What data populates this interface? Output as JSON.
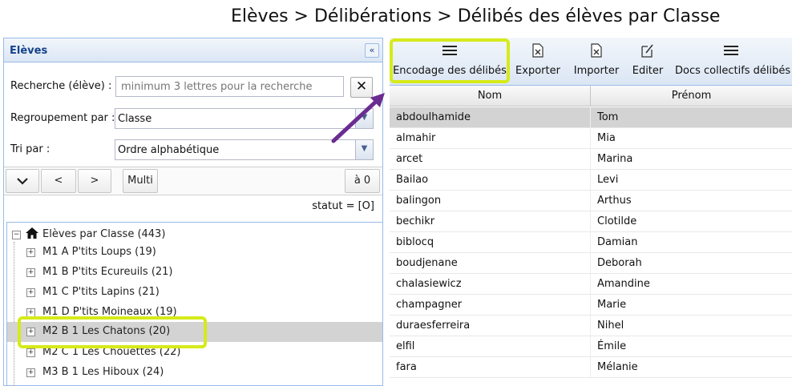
{
  "header": {
    "title": "Elèves > Délibérations > Délibés des élèves par Classe"
  },
  "left_panel": {
    "title": "Elèves",
    "search": {
      "label": "Recherche (élève) :",
      "placeholder": "minimum 3 lettres pour la recherche",
      "value": ""
    },
    "grouping": {
      "label": "Regroupement par :",
      "value": "Classe"
    },
    "sort": {
      "label": "Tri par :",
      "value": "Ordre alphabétique"
    },
    "nav": {
      "prev": "<",
      "next": ">",
      "multi": "Multi",
      "zero": "à 0"
    },
    "status": "statut = [O]",
    "tree": {
      "root": "Elèves par Classe (443)",
      "items": [
        {
          "label": "M1 A P'tits Loups (19)"
        },
        {
          "label": "M1 B P'tits Ecureuils (21)"
        },
        {
          "label": "M1 C P'tits Lapins (21)"
        },
        {
          "label": "M1 D P'tits Moineaux (19)"
        },
        {
          "label": "M2 B 1 Les Chatons (20)",
          "selected": true
        },
        {
          "label": "M2 C 1 Les Chouettes (22)"
        },
        {
          "label": "M3 B 1 Les Hiboux (24)"
        }
      ]
    }
  },
  "toolbar": {
    "encodage": "Encodage des délibés",
    "exporter": "Exporter",
    "importer": "Importer",
    "editer": "Editer",
    "docs": "Docs collectifs délibés"
  },
  "grid": {
    "columns": [
      "Nom",
      "Prénom"
    ],
    "rows": [
      {
        "nom": "abdoulhamide",
        "prenom": "Tom"
      },
      {
        "nom": "almahir",
        "prenom": "Mia"
      },
      {
        "nom": "arcet",
        "prenom": "Marina"
      },
      {
        "nom": "Bailao",
        "prenom": "Levi"
      },
      {
        "nom": "balingon",
        "prenom": "Arthus"
      },
      {
        "nom": "bechikr",
        "prenom": "Clotilde"
      },
      {
        "nom": "biblocq",
        "prenom": "Damian"
      },
      {
        "nom": "boudjenane",
        "prenom": "Deborah"
      },
      {
        "nom": "chalasiewicz",
        "prenom": "Amandine"
      },
      {
        "nom": "champagner",
        "prenom": "Marie"
      },
      {
        "nom": "duraesferreira",
        "prenom": "Nihel"
      },
      {
        "nom": "elfil",
        "prenom": "Émile"
      },
      {
        "nom": "fara",
        "prenom": "Mélanie"
      }
    ]
  },
  "colors": {
    "highlight": "#d6ea1a",
    "arrow": "#6a2c91",
    "panel_border": "#99bbe8",
    "selected_row": "#d3d3d3"
  }
}
